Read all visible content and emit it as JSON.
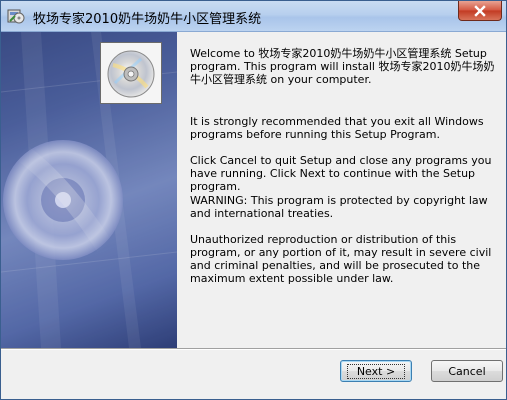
{
  "window": {
    "title": "牧场专家2010奶牛场奶牛小区管理系统"
  },
  "icons": {
    "app": "installer-icon",
    "close": "close-icon",
    "cd": "cd-disc-icon"
  },
  "content": {
    "welcome": "Welcome to 牧场专家2010奶牛场奶牛小区管理系统 Setup program. This program will install 牧场专家2010奶牛场奶牛小区管理系统 on your computer.",
    "recommend": "It is strongly recommended that you exit all Windows programs before running this Setup Program.",
    "cancel_info": "Click Cancel to quit Setup and close any programs you have running.  Click Next to continue with the Setup program.",
    "warning": "WARNING: This program is protected by copyright law and international treaties.",
    "unauthorized": "Unauthorized reproduction or distribution of this program, or any portion of it, may result in severe civil and criminal penalties, and will be prosecuted to the maximum extent possible under law."
  },
  "buttons": {
    "next": "Next >",
    "cancel": "Cancel"
  },
  "colors": {
    "panel_dark": "#3c4d86",
    "panel_light": "#7f92c7",
    "close_red": "#c23a22"
  }
}
